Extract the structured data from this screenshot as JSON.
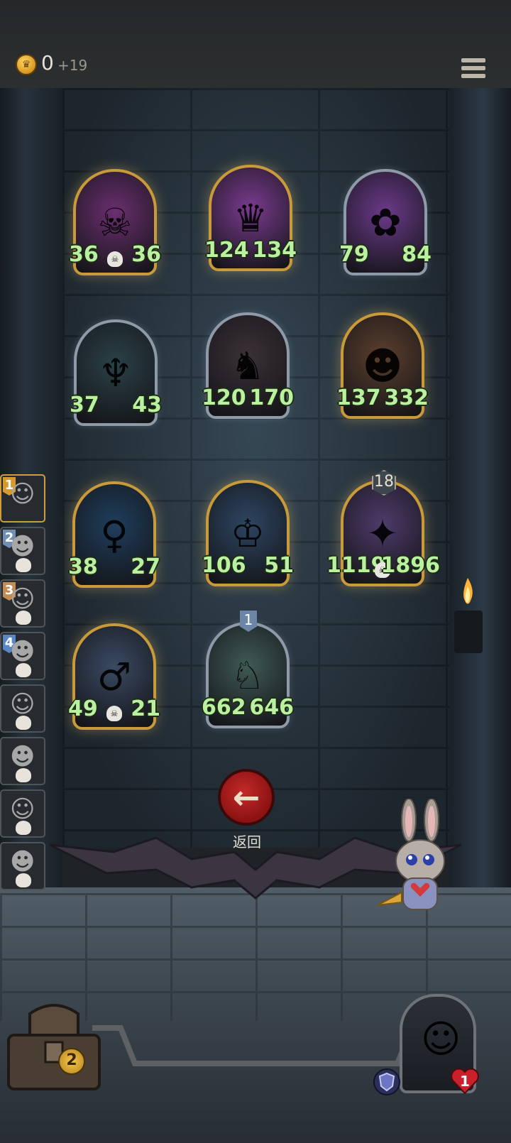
{
  "header": {
    "coins": "0",
    "coins_delta": "+19",
    "menu_icon": "hamburger-menu-icon"
  },
  "cards": [
    {
      "atk": "36",
      "hp": "36",
      "skull": true,
      "frame": "gold",
      "bg": "#6a2f6f",
      "glyph": "☠"
    },
    {
      "atk": "124",
      "hp": "134",
      "skull": false,
      "frame": "gold",
      "bg": "#7a3b8f",
      "glyph": "♛"
    },
    {
      "atk": "79",
      "hp": "84",
      "skull": false,
      "frame": "silver",
      "bg": "#6b3a8a",
      "glyph": "✿"
    },
    {
      "atk": "37",
      "hp": "43",
      "skull": false,
      "frame": "silver",
      "bg": "#2b4148",
      "glyph": "♆"
    },
    {
      "atk": "120",
      "hp": "170",
      "skull": false,
      "frame": "silver",
      "bg": "#3a3137",
      "glyph": "♞"
    },
    {
      "atk": "137",
      "hp": "332",
      "skull": false,
      "frame": "gold",
      "bg": "#5c3f2d",
      "glyph": "☻"
    },
    {
      "atk": "38",
      "hp": "27",
      "skull": false,
      "frame": "gold",
      "bg": "#1f3e5c",
      "glyph": "♀"
    },
    {
      "atk": "106",
      "hp": "51",
      "skull": false,
      "frame": "gold",
      "bg": "#2d4662",
      "glyph": "♔"
    },
    {
      "atk": "1119",
      "hp": "1896",
      "skull": true,
      "frame": "gold",
      "bg": "#4e3b6a",
      "glyph": "✦",
      "level": "18"
    },
    {
      "atk": "49",
      "hp": "21",
      "skull": true,
      "frame": "gold",
      "bg": "#3a4a63",
      "glyph": "♂"
    },
    {
      "atk": "662",
      "hp": "646",
      "skull": false,
      "frame": "silver",
      "bg": "#3f5a55",
      "glyph": "♘",
      "rank": "1"
    }
  ],
  "side_list": [
    {
      "num": "1",
      "num_color": "#d89a2e",
      "active": true
    },
    {
      "num": "2",
      "num_color": "#6f8fb7",
      "active": false
    },
    {
      "num": "3",
      "num_color": "#c38c55",
      "active": false
    },
    {
      "num": "4",
      "num_color": "#5b86c4",
      "active": false
    },
    {
      "num": "",
      "num_color": "",
      "active": false
    },
    {
      "num": "",
      "num_color": "",
      "active": false
    },
    {
      "num": "",
      "num_color": "",
      "active": false
    },
    {
      "num": "",
      "num_color": "",
      "active": false
    }
  ],
  "back": {
    "label": "返回",
    "icon": "arrow-left-icon"
  },
  "chest": {
    "count": "2"
  },
  "hero": {
    "hearts": "1"
  }
}
